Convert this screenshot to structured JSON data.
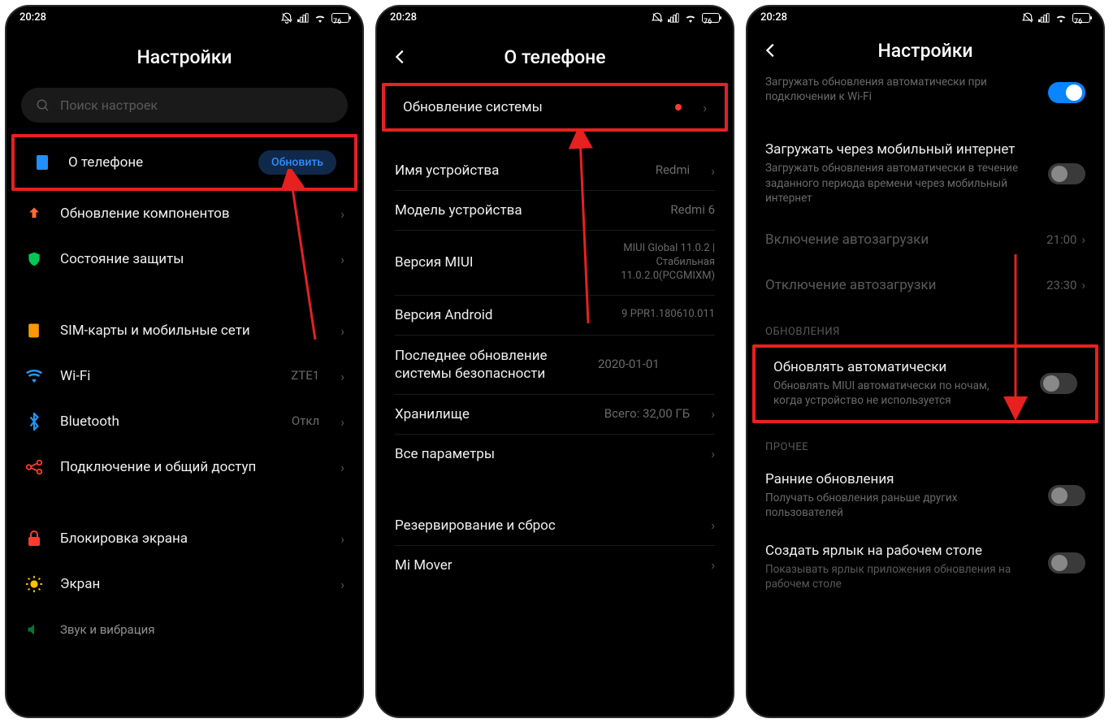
{
  "status": {
    "time": "20:28",
    "battery": "76"
  },
  "screen1": {
    "title": "Настройки",
    "searchPlaceholder": "Поиск настроек",
    "aboutPhone": {
      "label": "О телефоне",
      "button": "Обновить"
    },
    "items": [
      {
        "label": "Обновление компонентов"
      },
      {
        "label": "Состояние защиты"
      }
    ],
    "connectivity": [
      {
        "label": "SIM-карты и мобильные сети",
        "value": ""
      },
      {
        "label": "Wi-Fi",
        "value": "ZTE1"
      },
      {
        "label": "Bluetooth",
        "value": "Откл"
      },
      {
        "label": "Подключение и общий доступ",
        "value": ""
      }
    ],
    "system": [
      {
        "label": "Блокировка экрана"
      },
      {
        "label": "Экран"
      },
      {
        "label": "Звук и вибрация"
      }
    ]
  },
  "screen2": {
    "title": "О телефоне",
    "systemUpdate": "Обновление системы",
    "rows": [
      {
        "label": "Имя устройства",
        "value": "Redmi",
        "chevron": true
      },
      {
        "label": "Модель устройства",
        "value": "Redmi 6"
      },
      {
        "label": "Версия MIUI",
        "value": "MIUI Global 11.0.2 | Стабильная 11.0.2.0(PCGMIXM)",
        "small": true
      },
      {
        "label": "Версия Android",
        "value": "9 PPR1.180610.011"
      },
      {
        "label": "Последнее обновление системы безопасности",
        "value": "2020-01-01"
      },
      {
        "label": "Хранилище",
        "value": "Всего: 32,00 ГБ",
        "chevron": true
      },
      {
        "label": "Все параметры",
        "value": "",
        "chevron": true
      }
    ],
    "bottom": [
      {
        "label": "Резервирование и сброс"
      },
      {
        "label": "Mi Mover"
      }
    ]
  },
  "screen3": {
    "title": "Настройки",
    "autoWifi": {
      "sub": "Загружать обновления автоматически при подключении к Wi-Fi"
    },
    "mobile": {
      "title": "Загружать через мобильный интернет",
      "sub": "Загружать обновления автоматически в течение заданного периода времени через мобильный интернет"
    },
    "enableAuto": {
      "label": "Включение автозагрузки",
      "value": "21:00"
    },
    "disableAuto": {
      "label": "Отключение автозагрузки",
      "value": "23:30"
    },
    "updatesHeader": "ОБНОВЛЕНИЯ",
    "autoUpdate": {
      "title": "Обновлять автоматически",
      "sub": "Обновлять MIUI автоматически по ночам, когда устройство не используется"
    },
    "otherHeader": "ПРОЧЕЕ",
    "early": {
      "title": "Ранние обновления",
      "sub": "Получать обновления раньше других пользователей"
    },
    "shortcut": {
      "title": "Создать ярлык на рабочем столе",
      "sub": "Показывать ярлык приложения обновления на рабочем столе"
    }
  }
}
